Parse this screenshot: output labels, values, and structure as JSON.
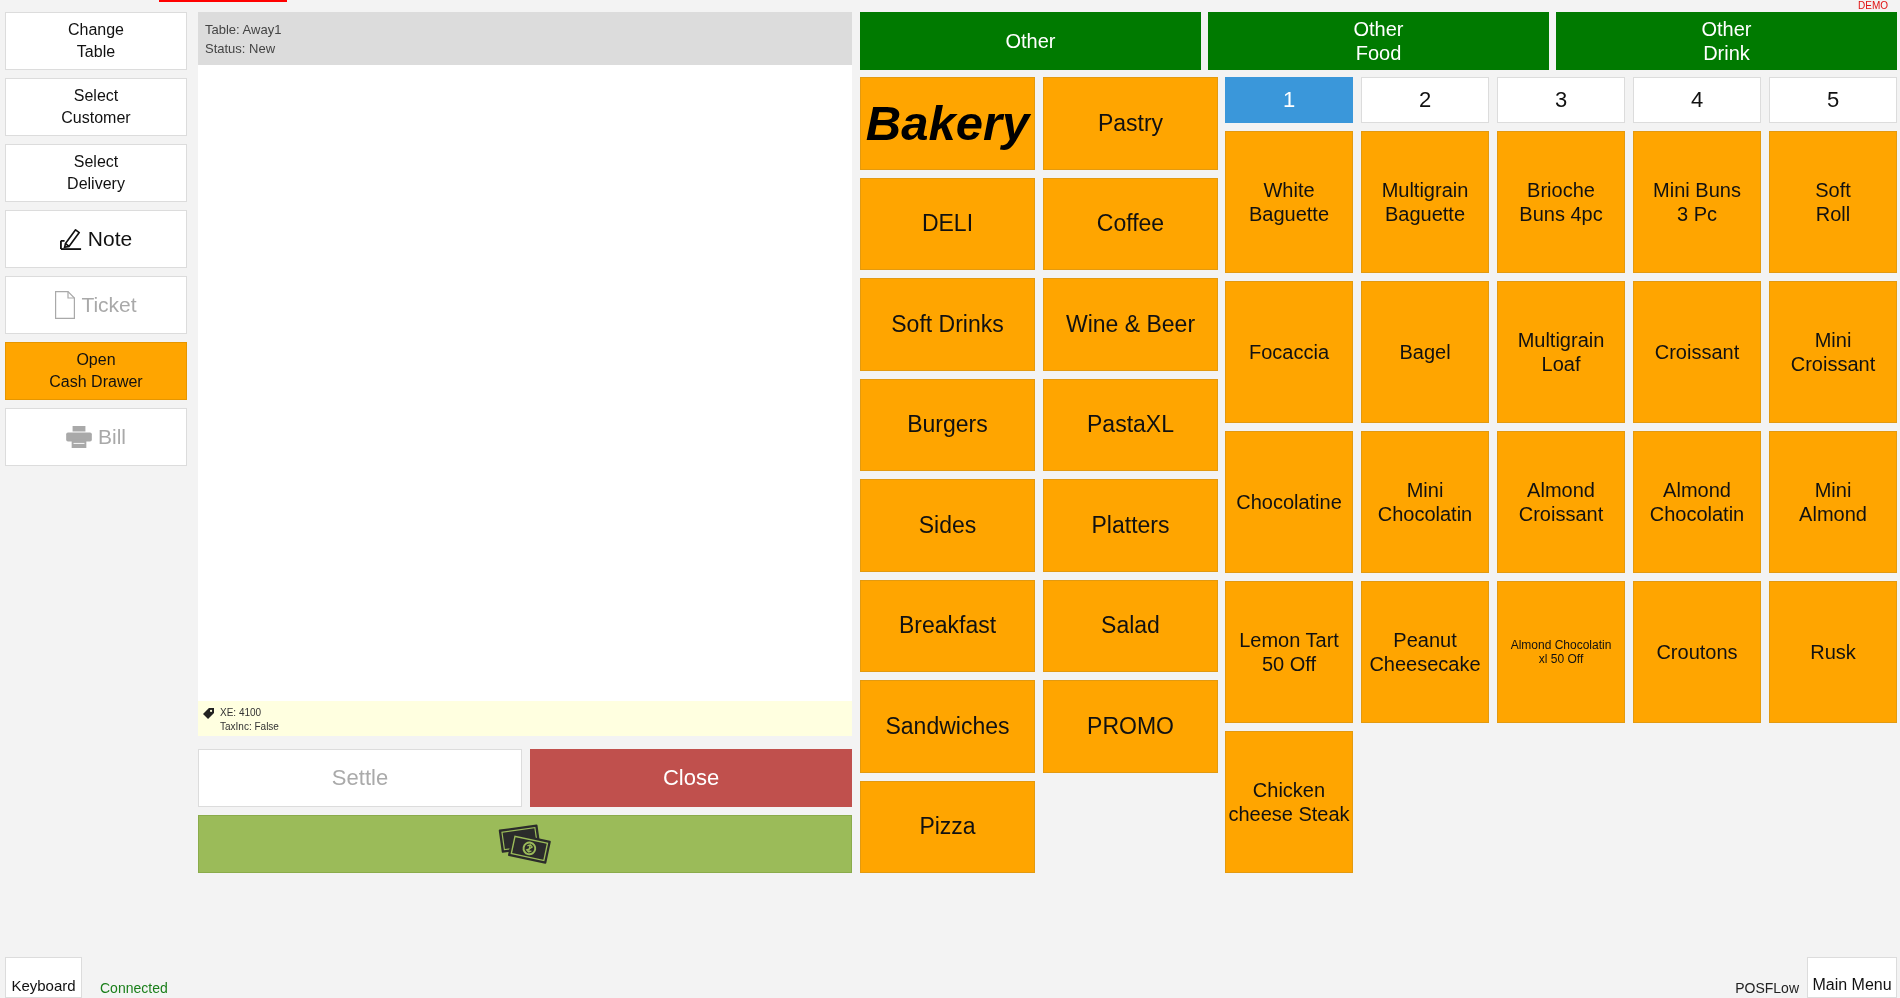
{
  "banner": {
    "text": "DEMO"
  },
  "actions": [
    {
      "label": "Change\nTable",
      "kind": "text",
      "disabled": false,
      "highlighted": false
    },
    {
      "label": "Select\nCustomer",
      "kind": "text",
      "disabled": false,
      "highlighted": false
    },
    {
      "label": "Select\nDelivery",
      "kind": "text",
      "disabled": false,
      "highlighted": false
    },
    {
      "label": "Note",
      "kind": "note",
      "disabled": false,
      "highlighted": false
    },
    {
      "label": "Ticket",
      "kind": "ticket",
      "disabled": true,
      "highlighted": false
    },
    {
      "label": "Open\nCash Drawer",
      "kind": "text",
      "disabled": false,
      "highlighted": true
    },
    {
      "label": "Bill",
      "kind": "bill",
      "disabled": true,
      "highlighted": false
    }
  ],
  "ticket": {
    "table": "Table: Away1",
    "status": "Status: New",
    "info": [
      "XE: 4100",
      "TaxInc: False"
    ]
  },
  "settle": {
    "label": "Settle",
    "disabled": true
  },
  "close": {
    "label": "Close"
  },
  "category_groups": [
    {
      "label": "Other"
    },
    {
      "label": "Other\nFood"
    },
    {
      "label": "Other\nDrink"
    }
  ],
  "categories": [
    {
      "label": "Bakery",
      "selected": true
    },
    {
      "label": "Pastry",
      "selected": false
    },
    {
      "label": "DELI",
      "selected": false
    },
    {
      "label": "Coffee",
      "selected": false
    },
    {
      "label": "Soft Drinks",
      "selected": false
    },
    {
      "label": "Wine & Beer",
      "selected": false
    },
    {
      "label": "Burgers",
      "selected": false
    },
    {
      "label": "PastaXL",
      "selected": false
    },
    {
      "label": "Sides",
      "selected": false
    },
    {
      "label": "Platters",
      "selected": false
    },
    {
      "label": "Breakfast",
      "selected": false
    },
    {
      "label": "Salad",
      "selected": false
    },
    {
      "label": "Sandwiches",
      "selected": false
    },
    {
      "label": "PROMO",
      "selected": false
    },
    {
      "label": "Pizza",
      "selected": false
    }
  ],
  "pages": [
    {
      "label": "1",
      "selected": true
    },
    {
      "label": "2",
      "selected": false
    },
    {
      "label": "3",
      "selected": false
    },
    {
      "label": "4",
      "selected": false
    },
    {
      "label": "5",
      "selected": false
    }
  ],
  "products": [
    {
      "label": "White\nBaguette",
      "kind": "regular"
    },
    {
      "label": "Multigrain\nBaguette",
      "kind": "regular"
    },
    {
      "label": "Brioche\nBuns 4pc",
      "kind": "regular"
    },
    {
      "label": "Mini Buns\n3 Pc",
      "kind": "regular"
    },
    {
      "label": "Soft\nRoll",
      "kind": "regular"
    },
    {
      "label": "Focaccia",
      "kind": "regular"
    },
    {
      "label": "Bagel",
      "kind": "regular"
    },
    {
      "label": "Multigrain\nLoaf",
      "kind": "regular"
    },
    {
      "label": "Croissant",
      "kind": "regular"
    },
    {
      "label": "Mini\nCroissant",
      "kind": "regular"
    },
    {
      "label": "Chocolatine",
      "kind": "regular"
    },
    {
      "label": "Mini\nChocolatin",
      "kind": "regular"
    },
    {
      "label": "Almond\nCroissant",
      "kind": "regular"
    },
    {
      "label": "Almond\nChocolatin",
      "kind": "regular"
    },
    {
      "label": "Mini\nAlmond",
      "kind": "regular"
    },
    {
      "label": "Lemon Tart\n50 Off",
      "kind": "regular"
    },
    {
      "label": "Peanut\nCheesecake",
      "kind": "regular"
    },
    {
      "label": "Almond Chocolatin\nxl 50 Off",
      "kind": "small"
    },
    {
      "label": "Croutons",
      "kind": "regular"
    },
    {
      "label": "Rusk",
      "kind": "regular"
    },
    {
      "label": "Chicken\ncheese Steak",
      "kind": "regular"
    }
  ],
  "status_bar": {
    "keyboard": "Keyboard",
    "connection": "Connected",
    "connected": true,
    "brand": "POSFLow",
    "main_menu": "Main Menu"
  }
}
